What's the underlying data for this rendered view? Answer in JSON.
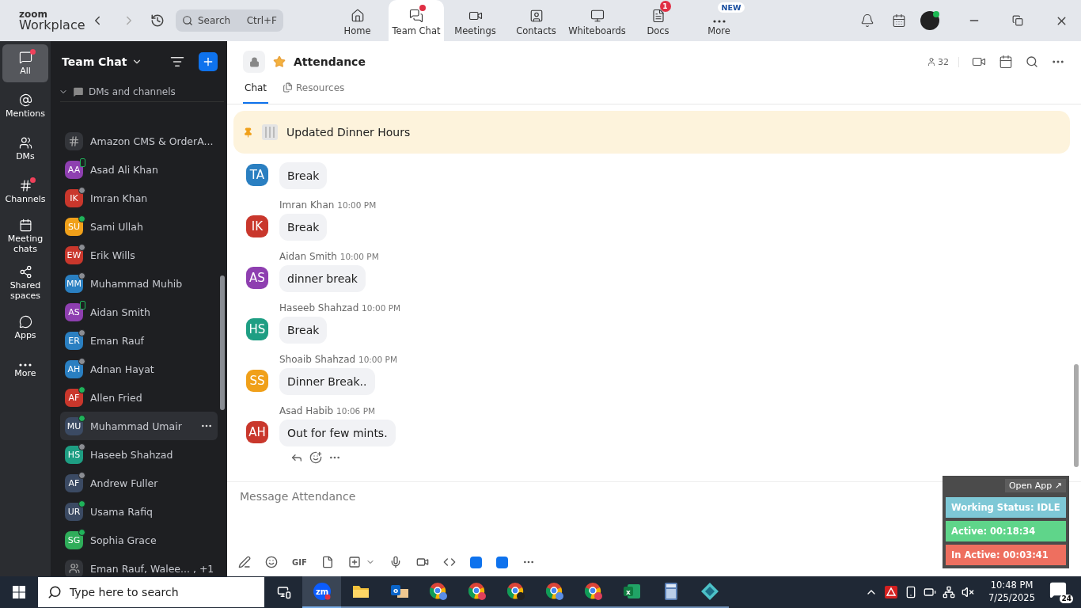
{
  "top_bar": {
    "logo": {
      "line1": "zoom",
      "line2": "Workplace"
    },
    "search": {
      "placeholder": "Search",
      "shortcut": "Ctrl+F"
    },
    "nav_tabs": [
      {
        "label": "Home",
        "selected": false
      },
      {
        "label": "Team Chat",
        "selected": true,
        "badge": {
          "kind": "dot"
        }
      },
      {
        "label": "Meetings",
        "selected": false
      },
      {
        "label": "Contacts",
        "selected": false
      },
      {
        "label": "Whiteboards",
        "selected": false
      },
      {
        "label": "Docs",
        "selected": false,
        "badge": {
          "kind": "count",
          "text": "1"
        }
      },
      {
        "label": "More",
        "selected": false,
        "badge": {
          "kind": "new",
          "text": "NEW"
        }
      }
    ]
  },
  "rail": [
    {
      "label": "All",
      "selected": true,
      "dot": true
    },
    {
      "label": "Mentions",
      "selected": false,
      "dot": false
    },
    {
      "label": "DMs",
      "selected": false,
      "dot": false
    },
    {
      "label": "Channels",
      "selected": false,
      "dot": true
    },
    {
      "label": "Meeting chats",
      "selected": false,
      "dot": false
    },
    {
      "label": "Shared spaces",
      "selected": false,
      "dot": false
    },
    {
      "label": "Apps",
      "selected": false,
      "dot": false
    },
    {
      "label": "More",
      "selected": false,
      "dot": false
    }
  ],
  "sidebar": {
    "title": "Team Chat",
    "section": {
      "label": "DMs and channels",
      "expanded": true
    },
    "items": [
      {
        "kind": "channel",
        "name": "Amazon CMS & OrderA...",
        "selected": false
      },
      {
        "kind": "person",
        "initials": "AA",
        "name": "Asad Ali Khan",
        "color": "#8e3fb0",
        "available": true,
        "mobile": true,
        "selected": false
      },
      {
        "kind": "person",
        "initials": "IK",
        "name": "Imran Khan",
        "color": "#c9372c",
        "available": false,
        "mobile": false,
        "selected": false
      },
      {
        "kind": "person",
        "initials": "SU",
        "name": "Sami Ullah",
        "color": "#f0a01a",
        "available": true,
        "mobile": false,
        "selected": false
      },
      {
        "kind": "person",
        "initials": "EW",
        "name": "Erik Wills",
        "color": "#c9372c",
        "available": false,
        "mobile": false,
        "selected": false
      },
      {
        "kind": "person",
        "initials": "MM",
        "name": "Muhammad Muhib",
        "color": "#2a7fc1",
        "available": false,
        "mobile": false,
        "selected": false
      },
      {
        "kind": "person",
        "initials": "AS",
        "name": "Aidan Smith",
        "color": "#8e3fb0",
        "available": true,
        "mobile": true,
        "selected": false
      },
      {
        "kind": "person",
        "initials": "ER",
        "name": "Eman Rauf",
        "color": "#2a7fc1",
        "available": false,
        "mobile": false,
        "selected": false
      },
      {
        "kind": "person",
        "initials": "AH",
        "name": "Adnan Hayat",
        "color": "#2a7fc1",
        "available": false,
        "mobile": false,
        "selected": false
      },
      {
        "kind": "person",
        "initials": "AF",
        "name": "Allen Fried",
        "color": "#c9372c",
        "available": true,
        "mobile": false,
        "selected": false
      },
      {
        "kind": "person",
        "initials": "MU",
        "name": "Muhammad Umair",
        "color": "#3b4a63",
        "available": true,
        "mobile": false,
        "selected": true
      },
      {
        "kind": "person",
        "initials": "HS",
        "name": "Haseeb Shahzad",
        "color": "#1e9e83",
        "available": false,
        "mobile": false,
        "selected": false
      },
      {
        "kind": "person",
        "initials": "AF",
        "name": "Andrew Fuller",
        "color": "#3b4a63",
        "available": false,
        "mobile": false,
        "selected": false
      },
      {
        "kind": "person",
        "initials": "UR",
        "name": "Usama Rafiq",
        "color": "#3b4a63",
        "available": true,
        "mobile": false,
        "selected": false
      },
      {
        "kind": "person",
        "initials": "SG",
        "name": "Sophia Grace",
        "color": "#2fad5a",
        "available": true,
        "mobile": false,
        "selected": false
      },
      {
        "kind": "group",
        "name": "Eman Rauf, Walee... , +1",
        "selected": false
      }
    ]
  },
  "chat": {
    "title": "Attendance",
    "starred": true,
    "member_count": "32",
    "tabs": [
      {
        "label": "Chat",
        "selected": true
      },
      {
        "label": "Resources",
        "selected": false
      }
    ],
    "pinned": "Updated Dinner Hours",
    "messages": [
      {
        "initials": "TA",
        "color": "#2a7fc1",
        "text": "Break"
      },
      {
        "initials": "IK",
        "color": "#c9372c",
        "sender": "Imran Khan",
        "time": "10:00 PM",
        "text": "Break"
      },
      {
        "initials": "AS",
        "color": "#8e3fb0",
        "sender": "Aidan Smith",
        "time": "10:00 PM",
        "text": "dinner break"
      },
      {
        "initials": "HS",
        "color": "#1e9e83",
        "sender": "Haseeb Shahzad",
        "time": "10:00 PM",
        "text": "Break"
      },
      {
        "initials": "SS",
        "color": "#f0a01a",
        "sender": "Shoaib Shahzad",
        "time": "10:00 PM",
        "text": "Dinner Break.."
      },
      {
        "initials": "AH",
        "color": "#c9372c",
        "sender": "Asad Habib",
        "time": "10:06 PM",
        "text": "Out for few mints."
      }
    ],
    "composer": {
      "placeholder": "Message Attendance",
      "gif": "GIF"
    }
  },
  "tracker": {
    "open_app": "Open App ↗",
    "rows": [
      {
        "text": "Working Status: IDLE",
        "color": "#7ec8d6"
      },
      {
        "text": "Active: 00:18:34",
        "color": "#5fd58a"
      },
      {
        "text": "In Active: 00:03:41",
        "color": "#ee6f5f"
      }
    ]
  },
  "taskbar": {
    "search": {
      "placeholder": "Type here to search"
    },
    "apps": [
      {
        "kind": "zoom",
        "label": "zm",
        "selected": true
      },
      {
        "kind": "files",
        "selected": false
      },
      {
        "kind": "outlook",
        "label": "o",
        "selected": false
      },
      {
        "kind": "chrome",
        "color": "#5b8ee6",
        "selected": false
      },
      {
        "kind": "chrome",
        "color": "#e0405a",
        "selected": false
      },
      {
        "kind": "chrome",
        "color": "#222222",
        "selected": false
      },
      {
        "kind": "chrome",
        "color": "#5b8ee6",
        "selected": false
      },
      {
        "kind": "chrome",
        "color": "#e0405a",
        "selected": false
      },
      {
        "kind": "excel",
        "label": "x",
        "selected": false
      },
      {
        "kind": "calculator",
        "selected": false
      },
      {
        "kind": "app",
        "selected": false
      }
    ],
    "time": "10:48 PM",
    "date": "7/25/2025",
    "notifications": "24"
  }
}
